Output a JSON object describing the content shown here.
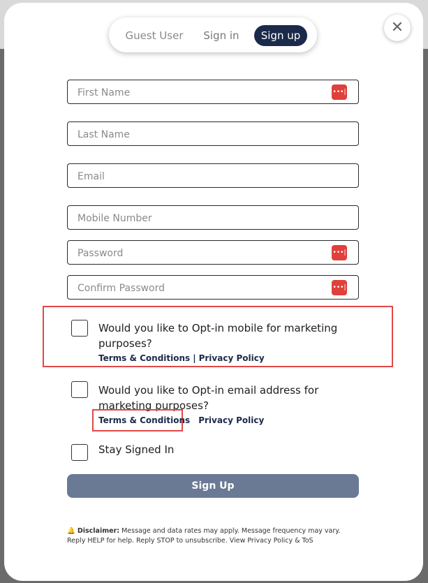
{
  "tabs": {
    "guest": "Guest User",
    "signin": "Sign in",
    "signup": "Sign up"
  },
  "close_glyph": "✕",
  "fields": {
    "first_name": "First Name",
    "last_name": "Last Name",
    "email": "Email",
    "mobile": "Mobile Number",
    "password": "Password",
    "confirm_password": "Confirm Password"
  },
  "password_icon_glyph": "•••|",
  "opt_in_mobile": {
    "text": "Would you like to Opt-in mobile for marketing purposes?",
    "terms": "Terms & Conditions",
    "separator": "|",
    "privacy": "Privacy Policy"
  },
  "opt_in_email": {
    "text": "Would you like to Opt-in email address for marketing purposes?",
    "terms": "Terms & Conditions",
    "privacy": "Privacy Policy"
  },
  "stay_signed_in": "Stay Signed In",
  "signup_button": "Sign Up",
  "disclaimer": {
    "label": "Disclaimer:",
    "text": "Message and data rates may apply. Message frequency may vary. Reply HELP for help. Reply STOP to unsubscribe. View Privacy Policy & ToS"
  },
  "colors": {
    "accent": "#1b2a4a",
    "button": "#6b7a94",
    "highlight": "#e04848",
    "pw_icon": "#e0403b"
  }
}
